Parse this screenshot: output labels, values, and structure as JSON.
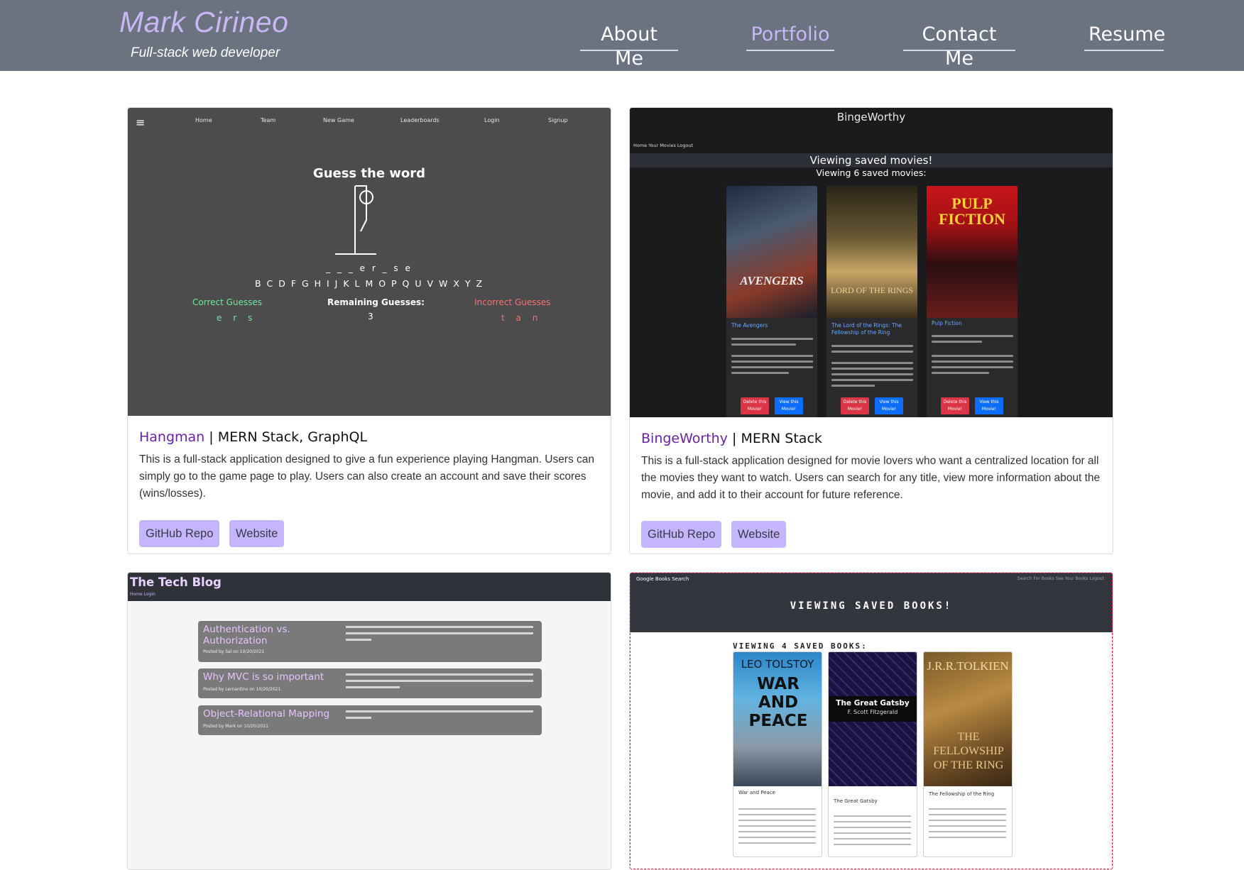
{
  "header": {
    "name": "Mark Cirineo",
    "tagline": "Full-stack web developer",
    "nav": [
      {
        "label": "About Me",
        "active": false
      },
      {
        "label": "Portfolio",
        "active": true
      },
      {
        "label": "Contact Me",
        "active": false
      },
      {
        "label": "Resume",
        "active": false
      }
    ]
  },
  "colors": {
    "header_bg": "#6b7280",
    "accent": "#c9b6f5",
    "button_bg": "#c4b5fd",
    "project_name": "#6b21a8"
  },
  "projects": [
    {
      "name": "Hangman",
      "separator": " | ",
      "stack": "MERN Stack, GraphQL",
      "description": "This is a full-stack application designed to give a fun experience playing Hangman. Users can simply go to the game page to play. Users can also create an account and save their scores (wins/losses).",
      "repo_label": "GitHub Repo",
      "site_label": "Website",
      "screenshot": {
        "menu_icon": "≡",
        "nav": [
          "Home",
          "Team",
          "New Game",
          "Leaderboards",
          "Login",
          "Signup"
        ],
        "title": "Guess the word",
        "word": "_ _ _ e r _ s e",
        "letters": "B C D F G H I J K L M O P Q U V W X Y Z",
        "correct_label": "Correct Guesses",
        "correct_value": "e r s",
        "remaining_label": "Remaining Guesses:",
        "remaining_value": "3",
        "incorrect_label": "Incorrect Guesses",
        "incorrect_value": "t a n"
      }
    },
    {
      "name": "BingeWorthy",
      "separator": " | ",
      "stack": "MERN Stack",
      "description": "This is a full-stack application designed for movie lovers who want a centralized location for all the movies they want to watch. Users can search for any title, view more information about the movie, and add it to their account for future reference.",
      "repo_label": "GitHub Repo",
      "site_label": "Website",
      "screenshot": {
        "app_title": "BingeWorthy",
        "mini_nav": "Home   Your Movies   Logout",
        "heading": "Viewing saved movies!",
        "subheading": "Viewing 6 saved movies:",
        "movies": [
          {
            "title": "The Avengers",
            "poster_text": "AVENGERS",
            "delete": "Delete this Movie!",
            "view": "View this Movie!"
          },
          {
            "title": "The Lord of the Rings: The Fellowship of the Ring",
            "poster_text": "LORD OF THE RINGS",
            "delete": "Delete this Movie!",
            "view": "View this Movie!"
          },
          {
            "title": "Pulp Fiction",
            "poster_text": "PULP FICTION",
            "delete": "Delete this Movie!",
            "view": "View this Movie!"
          }
        ]
      }
    },
    {
      "screenshot": {
        "title": "The Tech Blog",
        "mini_nav": "Home Login",
        "posts": [
          {
            "title": "Authentication vs. Authorization",
            "byline": "Posted by Sal on 10/20/2021"
          },
          {
            "title": "Why MVC is so important",
            "byline": "Posted by Lernantino on 10/20/2021"
          },
          {
            "title": "Object-Relational Mapping",
            "byline": "Posted by Mark on 10/20/2021"
          }
        ]
      }
    },
    {
      "screenshot": {
        "brand": "Google Books Search",
        "links": "Search For Books   See Your Books   Logout",
        "heading": "VIEWING SAVED BOOKS!",
        "subheading": "VIEWING 4 SAVED BOOKS:",
        "books": [
          {
            "title": "War and Peace",
            "cover_top": "LEO TOLSTOY",
            "cover_main": "WAR AND PEACE"
          },
          {
            "title": "The Great Gatsby",
            "cover_main": "The Great Gatsby",
            "cover_sub": "F. Scott Fitzgerald"
          },
          {
            "title": "The Fellowship of the Ring",
            "cover_top": "J.R.R.TOLKIEN",
            "cover_main": "THE FELLOWSHIP OF THE RING"
          }
        ]
      }
    }
  ]
}
